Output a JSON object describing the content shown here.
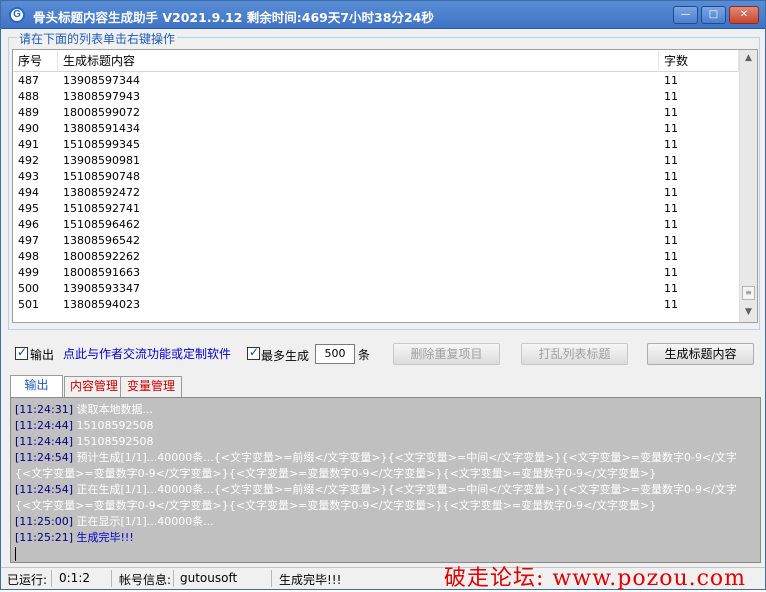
{
  "window": {
    "title": "骨头标题内容生成助手 V2021.9.12 剩余时间:469天7小时38分24秒",
    "app_icon_letter": "G",
    "buttons": [
      "minimize-icon",
      "maximize-icon",
      "close-icon"
    ]
  },
  "list_group": {
    "title": "请在下面的列表单击右键操作",
    "columns": [
      "序号",
      "生成标题内容",
      "字数"
    ],
    "rows": [
      {
        "no": "487",
        "content": "13908597344",
        "count": "11"
      },
      {
        "no": "488",
        "content": "13808597943",
        "count": "11"
      },
      {
        "no": "489",
        "content": "18008599072",
        "count": "11"
      },
      {
        "no": "490",
        "content": "13808591434",
        "count": "11"
      },
      {
        "no": "491",
        "content": "15108599345",
        "count": "11"
      },
      {
        "no": "492",
        "content": "13908590981",
        "count": "11"
      },
      {
        "no": "493",
        "content": "15108590748",
        "count": "11"
      },
      {
        "no": "494",
        "content": "13808592472",
        "count": "11"
      },
      {
        "no": "495",
        "content": "15108592741",
        "count": "11"
      },
      {
        "no": "496",
        "content": "15108596462",
        "count": "11"
      },
      {
        "no": "497",
        "content": "13808596542",
        "count": "11"
      },
      {
        "no": "498",
        "content": "18008592262",
        "count": "11"
      },
      {
        "no": "499",
        "content": "18008591663",
        "count": "11"
      },
      {
        "no": "500",
        "content": "13908593347",
        "count": "11"
      },
      {
        "no": "501",
        "content": "13808594023",
        "count": "11"
      }
    ]
  },
  "controls": {
    "output_checkbox_label": "输出",
    "output_checked": true,
    "contact_link": "点此与作者交流功能或定制软件",
    "max_gen_checkbox_label": "最多生成",
    "max_gen_checked": true,
    "max_gen_value": "500",
    "max_gen_unit": "条",
    "dedupe_button": "删除重复项目",
    "shuffle_button": "打乱列表标题",
    "generate_button": "生成标题内容"
  },
  "tabs": [
    {
      "label": "输出",
      "active": true
    },
    {
      "label": "内容管理",
      "active": false
    },
    {
      "label": "变量管理",
      "active": false
    }
  ],
  "log": [
    {
      "ts": "[11:24:31]",
      "msg": "读取本地数据..."
    },
    {
      "ts": "[11:24:44]",
      "msg": "15108592508"
    },
    {
      "ts": "[11:24:44]",
      "msg": "15108592508"
    },
    {
      "ts": "[11:24:54]",
      "msg": "预计生成[1/1]...40000条...{<文字变量>=前缀</文字变量>}{<文字变量>=中间</文字变量>}{<文字变量>=变量数字0-9</文字"
    },
    {
      "ts": "",
      "msg": "{<文字变量>=变量数字0-9</文字变量>}{<文字变量>=变量数字0-9</文字变量>}{<文字变量>=变量数字0-9</文字变量>}"
    },
    {
      "ts": "[11:24:54]",
      "msg": "正在生成[1/1]...40000条...{<文字变量>=前缀</文字变量>}{<文字变量>=中间</文字变量>}{<文字变量>=变量数字0-9</文字"
    },
    {
      "ts": "",
      "msg": "{<文字变量>=变量数字0-9</文字变量>}{<文字变量>=变量数字0-9</文字变量>}{<文字变量>=变量数字0-9</文字变量>}"
    },
    {
      "ts": "[11:25:00]",
      "msg": "正在显示[1/1]...40000条..."
    },
    {
      "ts": "[11:25:21]",
      "msg": "生成完毕!!!",
      "final": true
    }
  ],
  "status": {
    "running_label": "已运行:",
    "running_value": "0:1:2",
    "account_label": "帐号信息:",
    "account_value": "gutousoft",
    "state": "生成完毕!!!"
  },
  "watermark": "破走论坛: www.pozou.com",
  "colors": {
    "title_bar": "#3f73c4",
    "accent_blue": "#1e5bb8",
    "tab_red": "#cc0000",
    "log_bg": "#c0c0c0",
    "watermark_red": "#e00000"
  }
}
